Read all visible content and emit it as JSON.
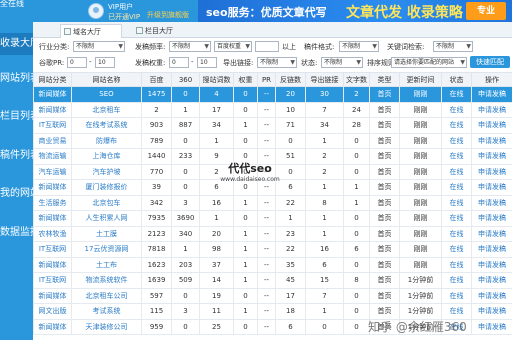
{
  "sidebar": {
    "brand": "全在线",
    "items": [
      {
        "label": "收录大厅",
        "active": true
      },
      {
        "label": "网站列表"
      },
      {
        "label": "栏目列表"
      },
      {
        "label": "稿件列表"
      },
      {
        "label": "我的网站"
      },
      {
        "label": "数据监控"
      }
    ]
  },
  "header": {
    "user_name": "VIP用户",
    "vip_line": "已开通VIP",
    "upgrade_label": "升级到旗舰版",
    "banner_left": "seo服务：优质文章代写",
    "banner_right": "文章代发 收录策略",
    "banner_badge": "专业"
  },
  "tabs": [
    {
      "label": "域名大厅",
      "active": true
    },
    {
      "label": "栏目大厅"
    }
  ],
  "filters": {
    "row1": {
      "industry_label": "行业分类:",
      "industry_value": "不限制",
      "release_label": "发稿频率:",
      "release_value": "不限制",
      "baidu_label": "百度权重",
      "baidu_value": "",
      "above_label": "以上",
      "format_label": "稿件格式:",
      "format_value": "不限制",
      "keyword_label": "关键词检索:",
      "keyword_value": "不限制"
    },
    "row2": {
      "br_label": "谷歌PR:",
      "br_from": "0",
      "br_to": "10",
      "weight_label": "发稿权重:",
      "weight_from": "0",
      "weight_to": "10",
      "link_label": "导出链接:",
      "link_value": "不限制",
      "status_label": "状态:",
      "status_value": "不限制",
      "sort_label": "排序规则:",
      "sort_value": "请选择你要匹配的网站",
      "search_label": "快速匹配"
    }
  },
  "table": {
    "headers": [
      "网站分类",
      "网站名称",
      "百度",
      "360",
      "搜站词数",
      "权重",
      "PR",
      "反链数",
      "导出链接",
      "文字数",
      "类型",
      "更新时间",
      "状态",
      "操作"
    ],
    "rows": [
      [
        "新闻媒体",
        "SEO",
        "1475",
        "0",
        "4",
        "0",
        "--",
        "20",
        "30",
        "2",
        "首页",
        "刚刚",
        "在线",
        "申请发稿"
      ],
      [
        "新闻媒体",
        "北京租车",
        "2",
        "1",
        "17",
        "0",
        "--",
        "10",
        "7",
        "24",
        "首页",
        "刚刚",
        "在线",
        "申请发稿"
      ],
      [
        "IT互联网",
        "在线考试系统",
        "903",
        "887",
        "34",
        "1",
        "--",
        "71",
        "34",
        "28",
        "首页",
        "刚刚",
        "在线",
        "申请发稿"
      ],
      [
        "商业贸易",
        "防爆布",
        "789",
        "0",
        "1",
        "0",
        "--",
        "0",
        "1",
        "0",
        "首页",
        "刚刚",
        "在线",
        "申请发稿"
      ],
      [
        "物流运输",
        "上海仓库",
        "1440",
        "233",
        "9",
        "0",
        "--",
        "51",
        "2",
        "0",
        "首页",
        "刚刚",
        "在线",
        "申请发稿"
      ],
      [
        "汽车运输",
        "汽车护坡",
        "770",
        "0",
        "2",
        "0",
        "--",
        "0",
        "2",
        "0",
        "首页",
        "刚刚",
        "在线",
        "申请发稿"
      ],
      [
        "新闻媒体",
        "厦门装修报价",
        "39",
        "0",
        "6",
        "0",
        "--",
        "6",
        "1",
        "1",
        "首页",
        "刚刚",
        "在线",
        "申请发稿"
      ],
      [
        "生活服务",
        "北京包车",
        "342",
        "3",
        "16",
        "1",
        "--",
        "22",
        "8",
        "1",
        "首页",
        "刚刚",
        "在线",
        "申请发稿"
      ],
      [
        "新闻媒体",
        "人生积累人网",
        "7935",
        "3690",
        "1",
        "0",
        "--",
        "1",
        "1",
        "0",
        "首页",
        "刚刚",
        "在线",
        "申请发稿"
      ],
      [
        "农林牧渔",
        "土工膜",
        "2123",
        "340",
        "20",
        "1",
        "--",
        "23",
        "1",
        "0",
        "首页",
        "刚刚",
        "在线",
        "申请发稿"
      ],
      [
        "IT互联网",
        "17云优资源网",
        "7818",
        "1",
        "98",
        "1",
        "--",
        "22",
        "16",
        "6",
        "首页",
        "刚刚",
        "在线",
        "申请发稿"
      ],
      [
        "新闻媒体",
        "土工布",
        "1623",
        "203",
        "37",
        "1",
        "--",
        "35",
        "6",
        "0",
        "首页",
        "刚刚",
        "在线",
        "申请发稿"
      ],
      [
        "IT互联网",
        "物流系统软件",
        "1639",
        "509",
        "14",
        "1",
        "--",
        "45",
        "15",
        "8",
        "首页",
        "1分钟前",
        "在线",
        "申请发稿"
      ],
      [
        "新闻媒体",
        "北京租车公司",
        "597",
        "0",
        "19",
        "0",
        "--",
        "17",
        "7",
        "0",
        "首页",
        "1分钟前",
        "在线",
        "申请发稿"
      ],
      [
        "网文出版",
        "考试系统",
        "115",
        "3",
        "11",
        "1",
        "--",
        "18",
        "1",
        "0",
        "首页",
        "1分钟前",
        "在线",
        "申请发稿"
      ],
      [
        "新闻媒体",
        "天津装修公司",
        "959",
        "0",
        "25",
        "0",
        "--",
        "6",
        "0",
        "0",
        "首页",
        "1分钟前",
        "在线",
        "申请发稿"
      ]
    ]
  },
  "watermarks": {
    "center_big": "代代seo",
    "center_small": "www.daidaiseo.com",
    "bottom": "知乎 @余红雁360"
  }
}
